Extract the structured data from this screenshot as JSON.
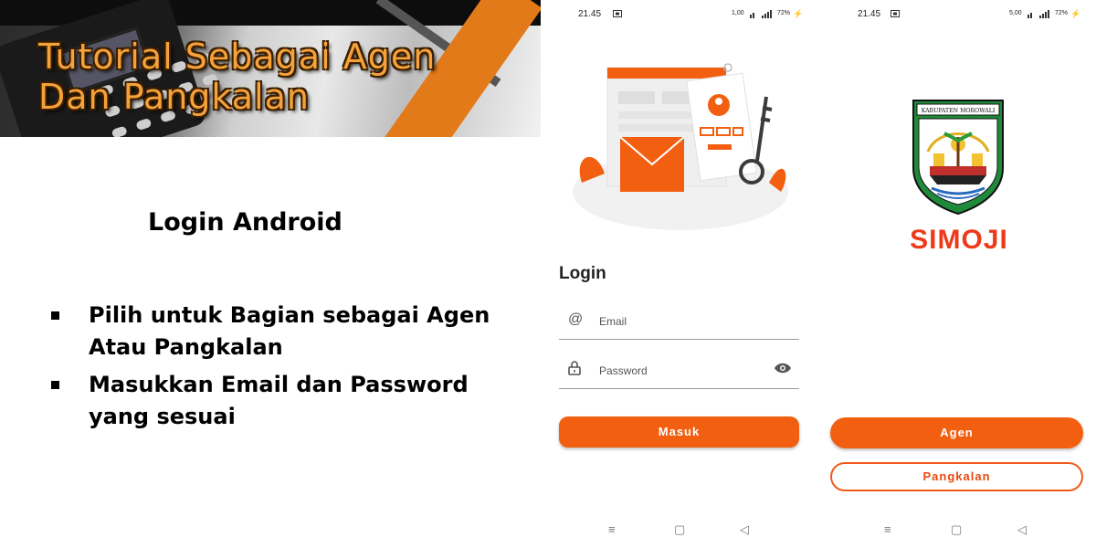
{
  "slide": {
    "banner_title_line1": "Tutorial Sebagai Agen",
    "banner_title_line2": "Dan Pangkalan",
    "heading": "Login Android",
    "bullets": [
      "Pilih untuk Bagian sebagai Agen Atau Pangkalan",
      "Masukkan Email dan Password yang sesuai"
    ]
  },
  "login_screen": {
    "status_time": "21.45",
    "status_speed": "1,00",
    "status_battery": "72%",
    "title": "Login",
    "email_placeholder": "Email",
    "password_placeholder": "Password",
    "submit_label": "Masuk",
    "email_icon": "at-icon",
    "password_icon": "lock-icon",
    "visibility_icon": "eye-icon"
  },
  "role_screen": {
    "status_time": "21.45",
    "status_speed": "5,00",
    "status_battery": "72%",
    "emblem_text": "KABUPATEN MOROWALI",
    "app_name": "SIMOJI",
    "agen_label": "Agen",
    "pangkalan_label": "Pangkalan"
  },
  "nav": {
    "menu_icon": "menu-icon",
    "home_icon": "home-icon",
    "back_icon": "back-icon"
  },
  "colors": {
    "accent": "#f25f10",
    "title_orange": "#f6a23a",
    "brand_red": "#ee3a1a"
  }
}
